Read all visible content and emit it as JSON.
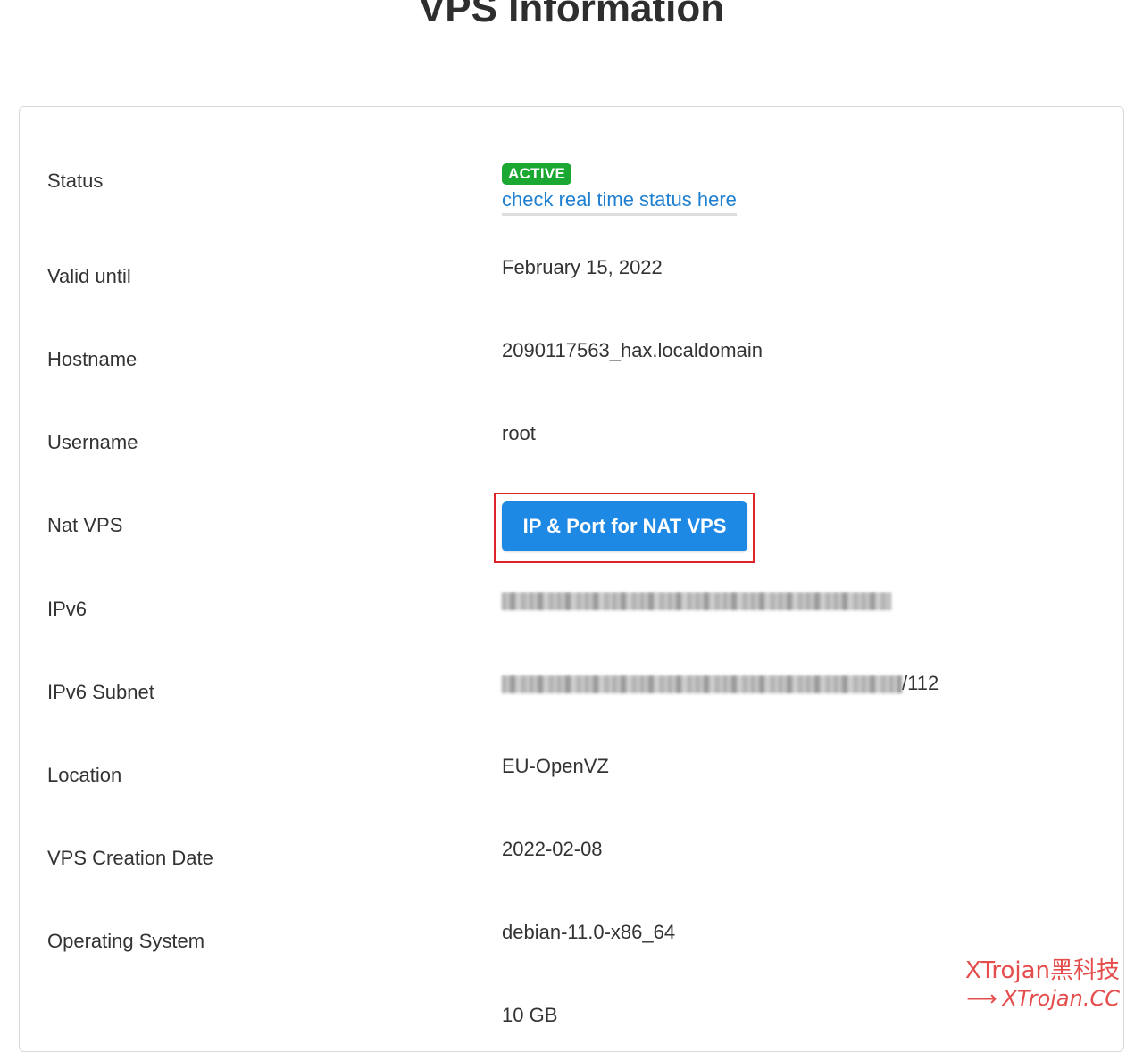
{
  "page": {
    "title": "VPS Information"
  },
  "status": {
    "label": "Status",
    "badge": "ACTIVE",
    "badge_color": "#1aa833",
    "link_text": "check real time status here",
    "link_color": "#1f7fd0"
  },
  "rows": {
    "valid_until": {
      "label": "Valid until",
      "value": "February 15, 2022"
    },
    "hostname": {
      "label": "Hostname",
      "value": "2090117563_hax.localdomain"
    },
    "username": {
      "label": "Username",
      "value": "root"
    },
    "nat_vps": {
      "label": "Nat VPS",
      "button_label": "IP & Port for NAT VPS",
      "button_color": "#1e88e5",
      "highlight_color": "#e0222a"
    },
    "ipv6": {
      "label": "IPv6"
    },
    "ipv6_subnet": {
      "label": "IPv6 Subnet",
      "value_suffix": "/112"
    },
    "location": {
      "label": "Location",
      "value": "EU-OpenVZ"
    },
    "creation_date": {
      "label": "VPS Creation Date",
      "value": "2022-02-08"
    },
    "os": {
      "label": "Operating System",
      "value": "debian-11.0-x86_64"
    },
    "disk": {
      "value": "10 GB"
    }
  },
  "watermark": {
    "line1": "XTrojan黑科技",
    "arrow": "⟶",
    "line2": "XTrojan.CC",
    "color": "#e33a3a"
  }
}
